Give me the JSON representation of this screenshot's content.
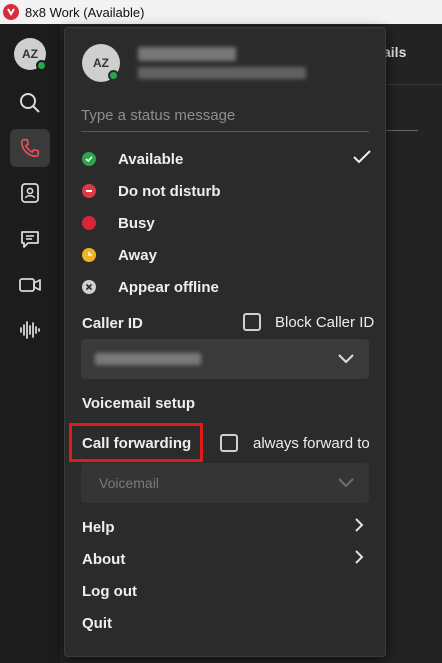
{
  "window": {
    "title": "8x8 Work (Available)"
  },
  "rail": {
    "avatar_initials": "AZ",
    "icons": [
      "search-icon",
      "phone-icon",
      "contacts-icon",
      "chat-icon",
      "video-icon",
      "voicemail-icon"
    ]
  },
  "background": {
    "tab_fragment": "ails"
  },
  "menu": {
    "avatar_initials": "AZ",
    "status_placeholder": "Type a status message",
    "statuses": [
      {
        "label": "Available",
        "color": "#2ea44f",
        "selected": true
      },
      {
        "label": "Do not disturb",
        "color": "#d93a45",
        "selected": false
      },
      {
        "label": "Busy",
        "color": "#d6263b",
        "selected": false
      },
      {
        "label": "Away",
        "color": "#f0b323",
        "selected": false
      },
      {
        "label": "Appear offline",
        "color": "#d0d0d0",
        "selected": false
      }
    ],
    "caller_id_label": "Caller ID",
    "block_caller_id_label": "Block Caller ID",
    "voicemail_setup_label": "Voicemail setup",
    "call_forwarding_label": "Call forwarding",
    "always_forward_label": "always forward to",
    "forward_dropdown_value": "Voicemail",
    "nav": {
      "help": "Help",
      "about": "About",
      "logout": "Log out",
      "quit": "Quit"
    }
  },
  "colors": {
    "accent_red": "#e01b1b",
    "available_green": "#2ea44f"
  }
}
